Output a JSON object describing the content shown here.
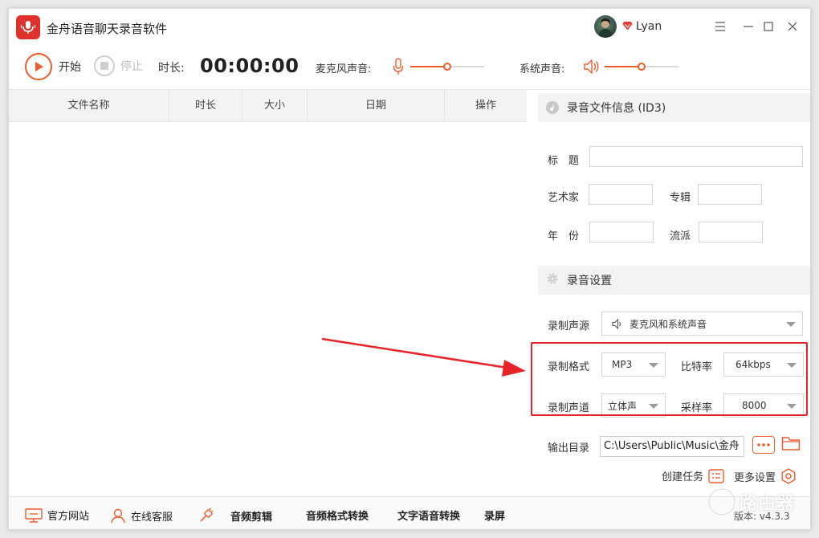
{
  "app": {
    "title": "金舟语音聊天录音软件",
    "user_name": "Lyan"
  },
  "toolbar": {
    "start_label": "开始",
    "stop_label": "停止",
    "duration_label": "时长:",
    "duration_value": "00:00:00",
    "mic_label": "麦克风声音:",
    "mic_level": 0.5,
    "sys_label": "系统声音:",
    "sys_level": 0.5
  },
  "file_table": {
    "columns": [
      "文件名称",
      "时长",
      "大小",
      "日期",
      "操作"
    ],
    "rows": []
  },
  "id3": {
    "section_title": "录音文件信息 (ID3)",
    "title_label": "标　题",
    "title_value": "",
    "artist_label": "艺术家",
    "artist_value": "",
    "album_label": "专辑",
    "album_value": "",
    "year_label": "年　份",
    "year_value": "",
    "genre_label": "流派",
    "genre_value": ""
  },
  "record_settings": {
    "section_title": "录音设置",
    "source_label": "录制声源",
    "source_value": "麦克风和系统声音",
    "format_label": "录制格式",
    "format_value": "MP3",
    "bitrate_label": "比特率",
    "bitrate_value": "64kbps",
    "channel_label": "录制声道",
    "channel_value": "立体声",
    "samplerate_label": "采样率",
    "samplerate_value": "8000",
    "output_label": "输出目录",
    "output_value": "C:\\Users\\Public\\Music\\金舟",
    "create_task_label": "创建任务",
    "more_settings_label": "更多设置"
  },
  "footer": {
    "website_label": "官方网站",
    "support_label": "在线客服",
    "audio_edit_label": "音频剪辑",
    "format_convert_label": "音频格式转换",
    "tts_label": "文字语音转换",
    "screen_record_label": "录屏",
    "version_label": "版本: v4.3.3"
  },
  "watermark": {
    "text": "路由器"
  },
  "colors": {
    "accent": "#ef5b2c",
    "highlight": "#e8232a",
    "logo": "#e0322c"
  }
}
